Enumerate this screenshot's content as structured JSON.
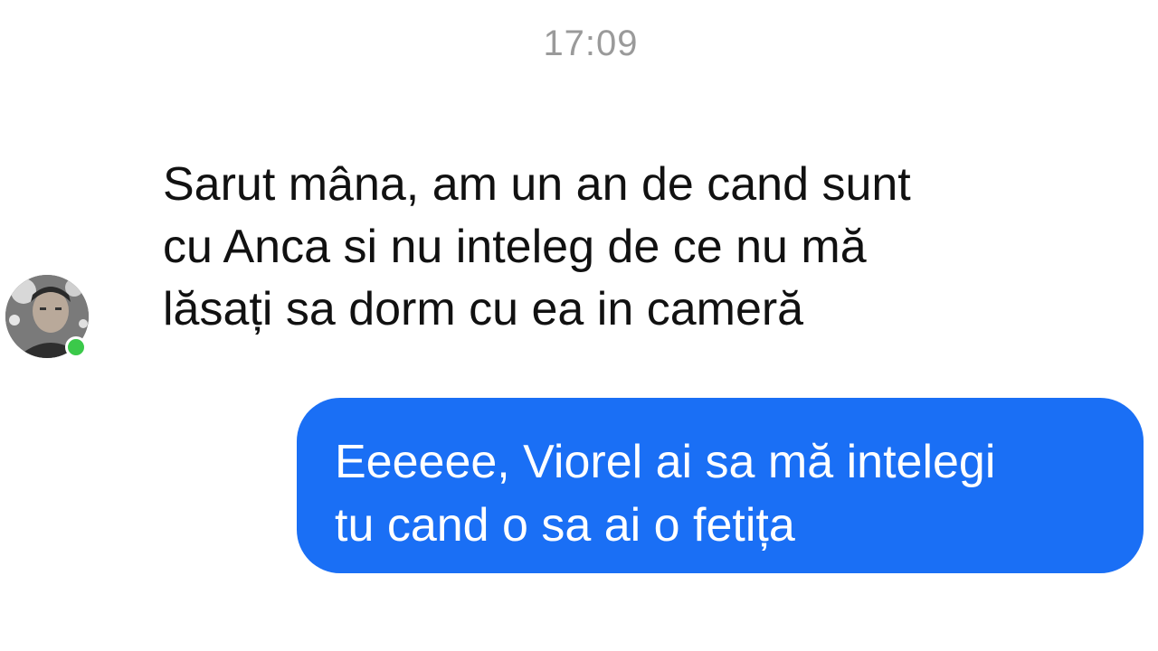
{
  "conversation": {
    "timestamp": "17:09",
    "messages": [
      {
        "direction": "incoming",
        "text": "Sarut mâna, am un an de cand sunt\ncu Anca si nu inteleg de ce nu mă\nlăsați sa dorm cu ea in cameră"
      },
      {
        "direction": "outgoing",
        "text": "Eeeeee, Viorel ai sa mă intelegi\ntu cand o sa ai o fetița"
      }
    ]
  },
  "colors": {
    "outgoing_bubble": "#1a6ff5",
    "incoming_text": "#111111",
    "timestamp_text": "#9a9a9a",
    "presence_online": "#3bc94a"
  },
  "icons": {
    "avatar": "contact-avatar-photo",
    "presence": "online-status-dot"
  }
}
